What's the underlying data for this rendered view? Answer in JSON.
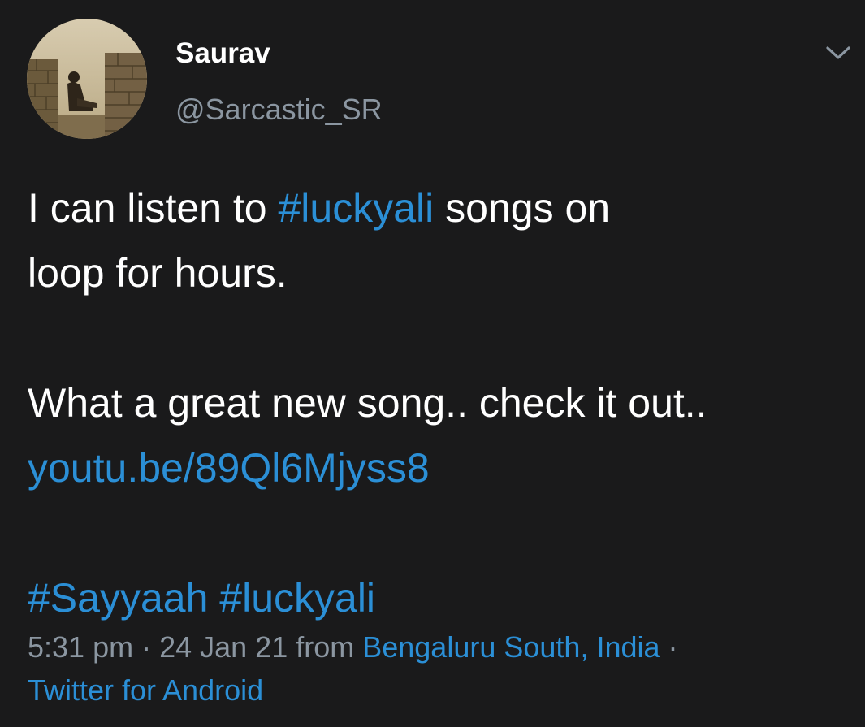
{
  "author": {
    "display_name": "Saurav",
    "handle": "@Sarcastic_SR"
  },
  "menu": {
    "icon": "chevron-down-icon"
  },
  "tweet": {
    "line1": {
      "pre": "I can listen to ",
      "hashtag": "#luckyali",
      "post": " songs on"
    },
    "line2": "loop for hours.",
    "line3": "What a great new song.. check it out..",
    "link": "youtu.be/89Ql6Mjyss8",
    "hashtags": [
      "#Sayyaah",
      "#luckyali"
    ]
  },
  "meta": {
    "time": "5:31 pm",
    "separator": " · ",
    "date": "24 Jan 21",
    "from": " from ",
    "location": "Bengaluru South, India",
    "trailing_separator": " ·",
    "source": "Twitter for Android"
  },
  "colors": {
    "background": "#1a1a1b",
    "text": "#ffffff",
    "secondary": "#8b96a1",
    "link": "#2b8fd6"
  }
}
